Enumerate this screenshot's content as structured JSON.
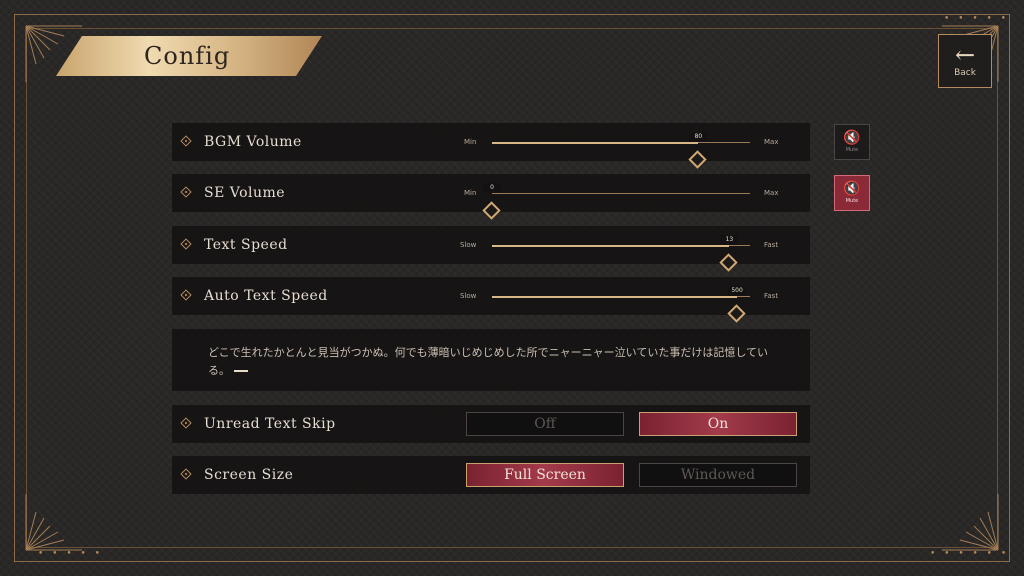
{
  "header": {
    "title": "Config",
    "back_label": "Back",
    "back_icon": "arrow-left-icon"
  },
  "sliders": [
    {
      "label": "BGM Volume",
      "min_label": "Min",
      "max_label": "Max",
      "value": "80",
      "fraction": 0.8,
      "muted": false
    },
    {
      "label": "SE Volume",
      "min_label": "Min",
      "max_label": "Max",
      "value": "0",
      "fraction": 0.0,
      "muted": true
    },
    {
      "label": "Text Speed",
      "min_label": "Slow",
      "max_label": "Fast",
      "value": "13",
      "fraction": 0.92
    },
    {
      "label": "Auto Text Speed",
      "min_label": "Slow",
      "max_label": "Fast",
      "value": "500",
      "fraction": 0.95
    }
  ],
  "mute": {
    "label": "Mute",
    "icon": "speaker-muted-icon"
  },
  "preview": {
    "text": "どこで生れたかとんと見当がつかぬ。何でも薄暗いじめじめした所でニャーニャー泣いていた事だけは記憶している。"
  },
  "unread_skip": {
    "label": "Unread Text Skip",
    "off_label": "Off",
    "on_label": "On",
    "selected": "On"
  },
  "screen_size": {
    "label": "Screen Size",
    "full_label": "Full Screen",
    "windowed_label": "Windowed",
    "selected": "Full Screen"
  },
  "colors": {
    "accent_gold": "#c8a46c",
    "active_red": "#a33a4b",
    "background": "#2a2727"
  }
}
